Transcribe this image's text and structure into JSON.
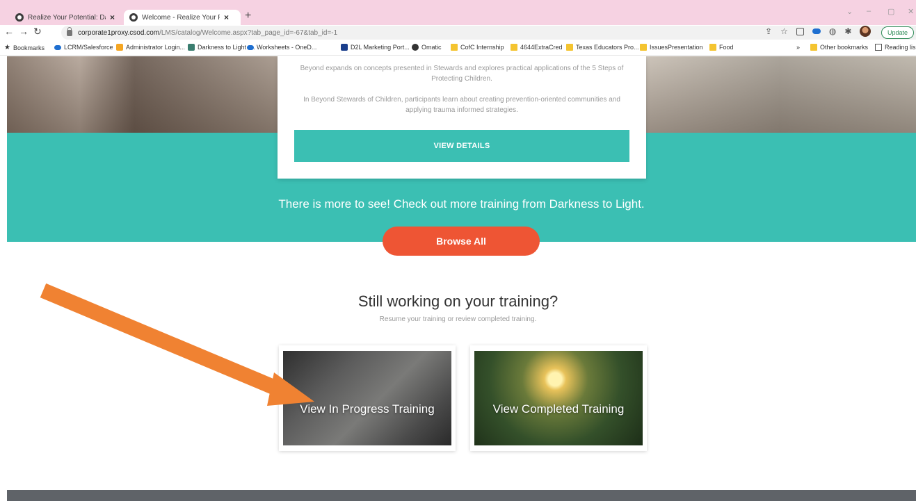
{
  "browser": {
    "tabs": [
      {
        "title": "Realize Your Potential: Darkness t",
        "active": false
      },
      {
        "title": "Welcome - Realize Your Potentia",
        "active": true
      }
    ],
    "new_tab": "+",
    "url_host": "corporate1proxy.csod.com",
    "url_path": "/LMS/catalog/Welcome.aspx?tab_page_id=-67&tab_id=-1",
    "update_label": "Update",
    "bookmarks": [
      {
        "label": "Bookmarks",
        "icon": "star-icon"
      },
      {
        "label": "LCRM/Salesforce",
        "icon": "cloud-icon"
      },
      {
        "label": "Administrator Login...",
        "icon": "admin-icon"
      },
      {
        "label": "Darkness to Light -...",
        "icon": "d2l-icon"
      },
      {
        "label": "Worksheets - OneD...",
        "icon": "onedrive-icon"
      },
      {
        "label": "D2L Marketing Port...",
        "icon": "d2l-portal-icon"
      },
      {
        "label": "Omatic",
        "icon": "omatic-icon"
      },
      {
        "label": "CofC Internship",
        "icon": "folder-icon"
      },
      {
        "label": "4644ExtraCred",
        "icon": "folder-icon"
      },
      {
        "label": "Texas Educators Pro...",
        "icon": "folder-icon"
      },
      {
        "label": "IssuesPresentation",
        "icon": "folder-icon"
      },
      {
        "label": "Food",
        "icon": "folder-icon"
      }
    ],
    "bookmarks_overflow": "»",
    "other_bookmarks": "Other bookmarks",
    "reading_list": "Reading lis"
  },
  "course_card": {
    "desc_1": "Beyond expands on concepts presented in Stewards and explores practical applications of the 5 Steps of Protecting Children.",
    "desc_2": "In Beyond Stewards of Children, participants learn about creating prevention-oriented communities and applying trauma informed strategies.",
    "button_label": "VIEW DETAILS"
  },
  "more_training_text": "There is more to see! Check out more training from Darkness to Light.",
  "browse_all_label": "Browse All",
  "still_working": {
    "title": "Still working on your training?",
    "subtitle": "Resume your training or review completed training."
  },
  "tiles": [
    {
      "label": "View In Progress Training"
    },
    {
      "label": "View Completed Training"
    }
  ],
  "colors": {
    "teal": "#3bbfb3",
    "orange_button": "#ee5534",
    "arrow": "#f08232"
  }
}
